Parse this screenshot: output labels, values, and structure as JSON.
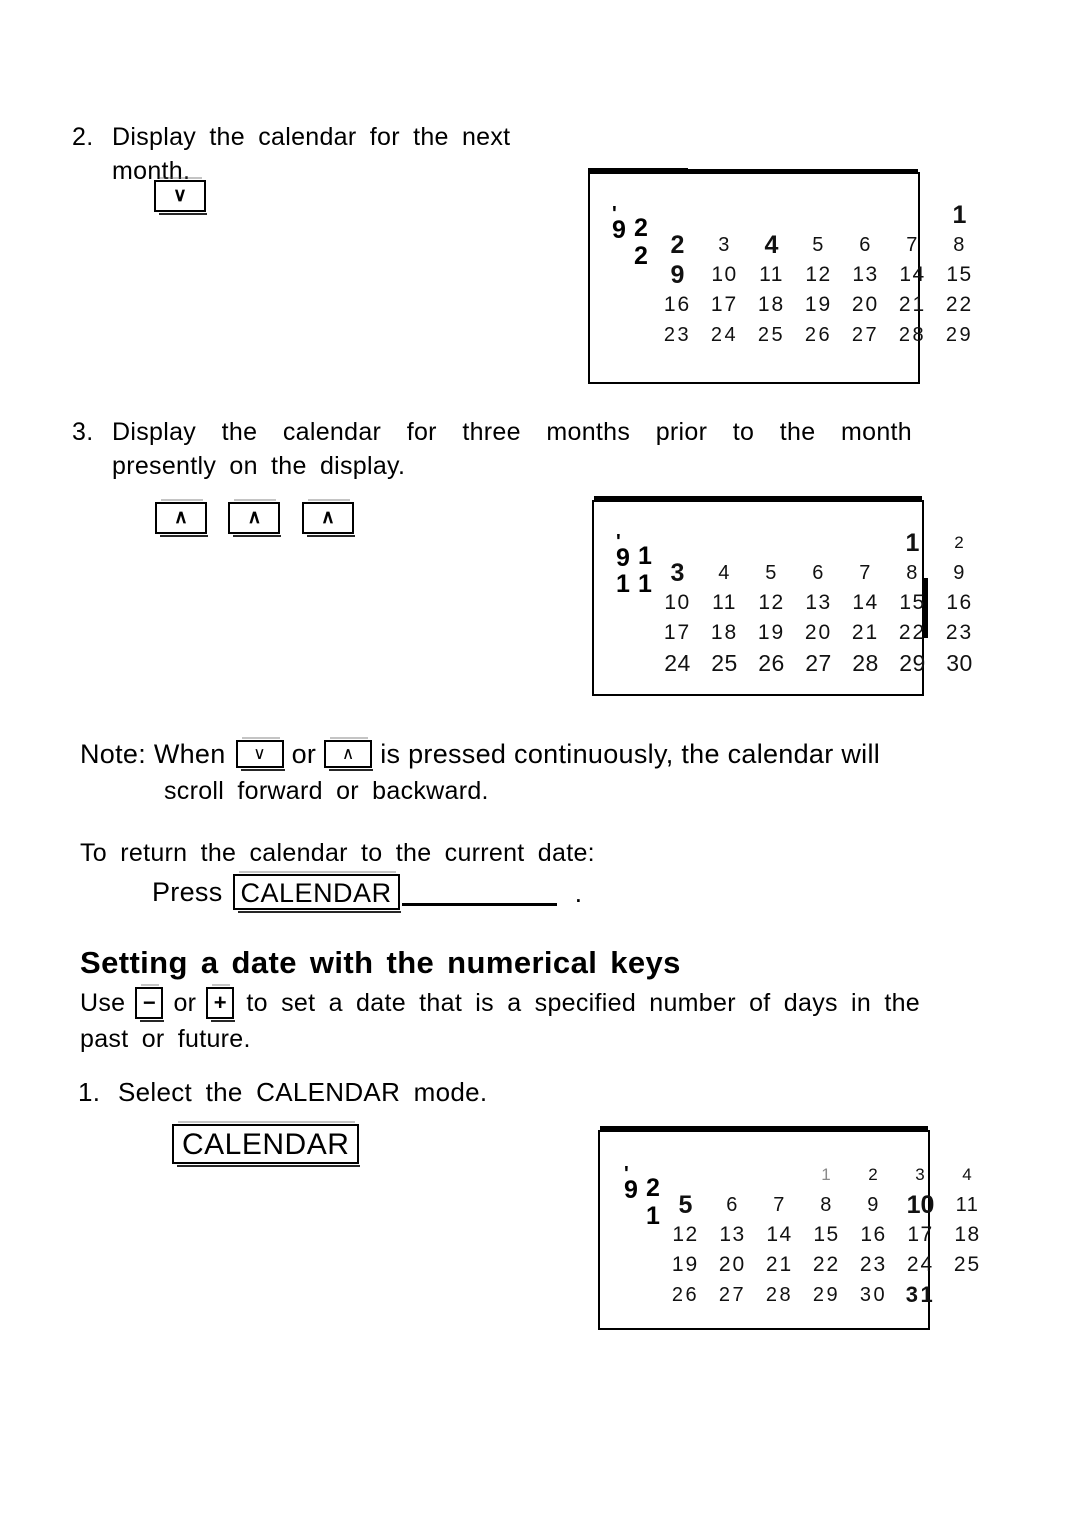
{
  "page": {
    "steps": [
      {
        "number": "2.",
        "text": "Display the calendar for the next month."
      },
      {
        "number": "3.",
        "text": "Display the calendar for three months prior to the month presently on the display."
      },
      {
        "number": "1.",
        "text": "Select the CALENDAR mode."
      }
    ],
    "note": {
      "label": "Note: When",
      "mid": "or",
      "after": "is pressed continuously, the calendar will",
      "second_line": "scroll forward or backward.",
      "key_down": "∨",
      "key_up": "∧"
    },
    "return_line": {
      "text": "To return the calendar to the current date:",
      "press_label": "Press",
      "key_label": "CALENDAR",
      "period": "."
    },
    "section": {
      "heading": "Setting a date with the numerical keys",
      "use_label": "Use",
      "key_minus": "−",
      "or_label": "or",
      "key_plus": "+",
      "after_keys": "to set a date that is a specified number of days in the",
      "second_line": "past or future."
    },
    "keys": {
      "down_arrow": "∨",
      "up_arrow": "∧",
      "calendar": "CALENDAR"
    },
    "step3_keys": [
      "∧",
      "∧",
      "∧"
    ]
  },
  "displays": [
    {
      "id": "display-feb-1992",
      "year_apostrophe": "'",
      "year": "92",
      "month": "2",
      "month_digits": [
        "2"
      ],
      "month_stack": [
        "2",
        "2"
      ],
      "weeks": [
        [
          "",
          "",
          "",
          "",
          "",
          "",
          "1"
        ],
        [
          "2",
          "3",
          "4",
          "5",
          "6",
          "7",
          "8"
        ],
        [
          "9",
          "10",
          "11",
          "12",
          "13",
          "14",
          "15"
        ],
        [
          "16",
          "17",
          "18",
          "19",
          "20",
          "21",
          "22"
        ],
        [
          "23",
          "24",
          "25",
          "26",
          "27",
          "28",
          "29"
        ]
      ],
      "highlight": "4"
    },
    {
      "id": "display-nov-1991",
      "year_apostrophe": "'",
      "year": "91",
      "month": "11",
      "month_digits": [
        "1",
        "1"
      ],
      "month_stack": [
        "1",
        "1"
      ],
      "weeks": [
        [
          "",
          "",
          "",
          "",
          "",
          "1",
          "2"
        ],
        [
          "3",
          "4",
          "5",
          "6",
          "7",
          "8",
          "9"
        ],
        [
          "10",
          "11",
          "12",
          "13",
          "14",
          "15",
          "16"
        ],
        [
          "17",
          "18",
          "19",
          "20",
          "21",
          "22",
          "23"
        ],
        [
          "24",
          "25",
          "26",
          "27",
          "28",
          "29",
          "30"
        ]
      ],
      "highlight": "3"
    },
    {
      "id": "display-jan-1992",
      "year_apostrophe": "'",
      "year": "92",
      "month": "1",
      "month_digits": [
        "1"
      ],
      "month_stack": [
        "1"
      ],
      "weeks": [
        [
          "",
          "",
          "",
          "1",
          "2",
          "3",
          "4"
        ],
        [
          "5",
          "6",
          "7",
          "8",
          "9",
          "10",
          "11"
        ],
        [
          "12",
          "13",
          "14",
          "15",
          "16",
          "17",
          "18"
        ],
        [
          "19",
          "20",
          "21",
          "22",
          "23",
          "24",
          "25"
        ],
        [
          "26",
          "27",
          "28",
          "29",
          "30",
          "31",
          ""
        ]
      ],
      "highlight": "10"
    }
  ]
}
